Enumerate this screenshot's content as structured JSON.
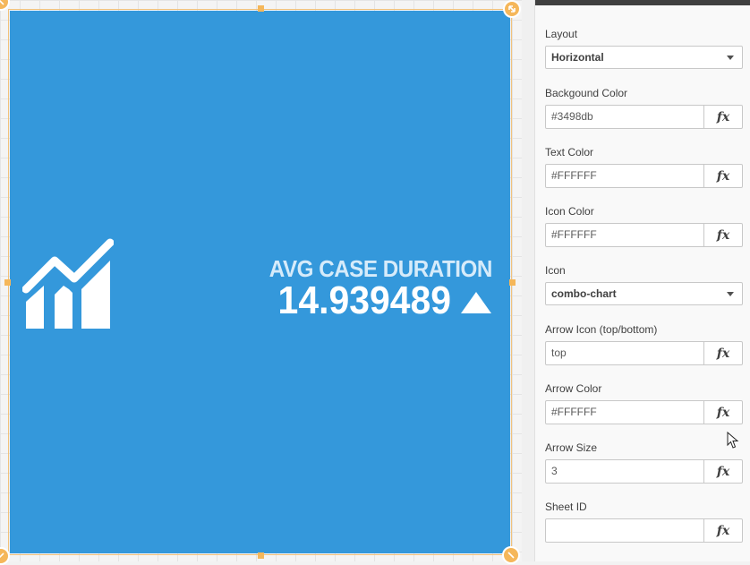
{
  "kpi": {
    "label": "AVG CASE DURATION",
    "value": "14.939489",
    "background_color": "#3498db",
    "text_color": "#FFFFFF",
    "icon": "combo-chart-icon",
    "arrow_icon": "triangle-up-icon"
  },
  "properties": {
    "layout": {
      "label": "Layout",
      "value": "Horizontal"
    },
    "background_color": {
      "label": "Backgound Color",
      "value": "#3498db",
      "fx": "fx"
    },
    "text_color": {
      "label": "Text Color",
      "value": "#FFFFFF",
      "fx": "fx"
    },
    "icon_color": {
      "label": "Icon Color",
      "value": "#FFFFFF",
      "fx": "fx"
    },
    "icon": {
      "label": "Icon",
      "value": "combo-chart"
    },
    "arrow_icon": {
      "label": "Arrow Icon (top/bottom)",
      "value": "top",
      "fx": "fx"
    },
    "arrow_color": {
      "label": "Arrow Color",
      "value": "#FFFFFF",
      "fx": "fx"
    },
    "arrow_size": {
      "label": "Arrow Size",
      "value": "3",
      "fx": "fx"
    },
    "sheet_id": {
      "label": "Sheet ID",
      "value": "",
      "fx": "fx"
    }
  },
  "colors": {
    "selection_border": "#f2c27b",
    "handle": "#f5b75a",
    "panel_header": "#404040"
  }
}
